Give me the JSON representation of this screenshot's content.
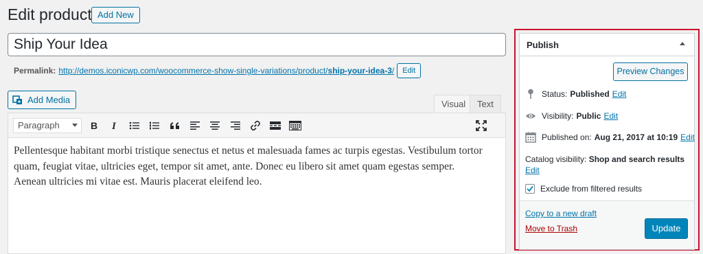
{
  "header": {
    "title": "Edit product",
    "add_new_label": "Add New"
  },
  "post": {
    "title": "Ship Your Idea",
    "permalink_label": "Permalink:",
    "permalink_base": "http://demos.iconicwp.com/woocommerce-show-single-variations/product/",
    "permalink_slug": "ship-your-idea-3",
    "permalink_trailing": "/",
    "permalink_edit_label": "Edit"
  },
  "editor": {
    "add_media_label": "Add Media",
    "tabs": [
      {
        "label": "Visual",
        "active": true
      },
      {
        "label": "Text",
        "active": false
      }
    ],
    "format_select_value": "Paragraph",
    "toolbar_icons": [
      "bold-icon",
      "italic-icon",
      "bullet-list-icon",
      "numbered-list-icon",
      "blockquote-icon",
      "align-left-icon",
      "align-center-icon",
      "align-right-icon",
      "link-icon",
      "read-more-icon",
      "toolbar-toggle-icon",
      "fullscreen-icon"
    ],
    "content": "Pellentesque habitant morbi tristique senectus et netus et malesuada fames ac turpis egestas. Vestibulum tortor quam, feugiat vitae, ultricies eget, tempor sit amet, ante. Donec eu libero sit amet quam egestas semper. Aenean ultricies mi vitae est. Mauris placerat eleifend leo."
  },
  "publish_box": {
    "title": "Publish",
    "preview_label": "Preview Changes",
    "status_label": "Status:",
    "status_value": "Published",
    "visibility_label": "Visibility:",
    "visibility_value": "Public",
    "published_label": "Published on:",
    "published_value": "Aug 21, 2017 at 10:19",
    "edit_label": "Edit",
    "catalog_label": "Catalog visibility:",
    "catalog_value": "Shop and search results",
    "exclude_label": "Exclude from filtered results",
    "exclude_checked": true,
    "copy_draft_label": "Copy to a new draft",
    "trash_label": "Move to Trash",
    "update_label": "Update"
  },
  "colors": {
    "accent": "#0073aa",
    "primary_button": "#0085ba",
    "highlight_border": "#c8102e",
    "trash": "#aa0000"
  }
}
